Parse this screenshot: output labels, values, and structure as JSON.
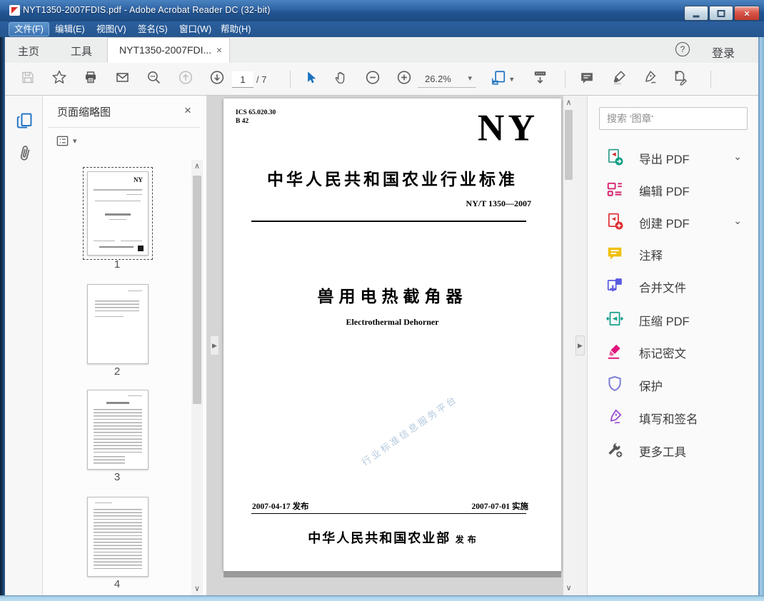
{
  "window": {
    "title": "NYT1350-2007FDIS.pdf - Adobe Acrobat Reader DC (32-bit)"
  },
  "menu": {
    "items": [
      "文件(F)",
      "编辑(E)",
      "视图(V)",
      "签名(S)",
      "窗口(W)",
      "帮助(H)"
    ]
  },
  "tabs": {
    "home": "主页",
    "tools": "工具",
    "document": "NYT1350-2007FDI...",
    "sign_in": "登录"
  },
  "toolbar": {
    "page_current": "1",
    "page_total": "/ 7",
    "zoom_level": "26.2%"
  },
  "icons": {
    "close": "×",
    "help": "?",
    "caret_down": "▾",
    "chevron_down": "⌄",
    "scroll_up": "∧",
    "scroll_down": "∨",
    "collapse": "▶"
  },
  "left_panel": {
    "title": "页面缩略图",
    "thumbnails": [
      {
        "label": "1"
      },
      {
        "label": "2"
      },
      {
        "label": "3"
      },
      {
        "label": "4"
      }
    ]
  },
  "document": {
    "ics_code": "ICS 65.020.30\nB 42",
    "logo": "NY",
    "std_title": "中华人民共和国农业行业标准",
    "std_no": "NY/T 1350—2007",
    "title_cn": "兽用电热截角器",
    "title_en": "Electrothermal  Dehorner",
    "watermark": "行业标准信息服务平台",
    "issue_date": "2007-04-17 发布",
    "impl_date": "2007-07-01 实施",
    "publisher": "中华人民共和国农业部",
    "publisher_suffix": "发 布"
  },
  "right_panel": {
    "search_placeholder": "搜索 '图章'",
    "tools": [
      {
        "label": "导出 PDF",
        "color": "#17a08b"
      },
      {
        "label": "编辑 PDF",
        "color": "#d6246e"
      },
      {
        "label": "创建 PDF",
        "color": "#df3034"
      },
      {
        "label": "注释",
        "color": "#f0c011"
      },
      {
        "label": "合并文件",
        "color": "#5a5ae0"
      },
      {
        "label": "压缩 PDF",
        "color": "#17a08b"
      },
      {
        "label": "标记密文",
        "color": "#e0147a"
      },
      {
        "label": "保护",
        "color": "#7b7bd6"
      },
      {
        "label": "填写和签名",
        "color": "#9a4fd1"
      },
      {
        "label": "更多工具",
        "color": "#575757"
      }
    ]
  }
}
